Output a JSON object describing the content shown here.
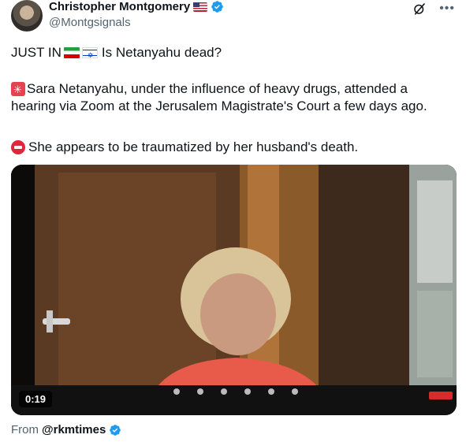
{
  "author": {
    "name": "Christopher Montgomery",
    "handle": "@Montgsignals"
  },
  "tweet": {
    "line1_prefix": "JUST IN",
    "line1_suffix": "Is Netanyahu dead?",
    "line2": "Sara Netanyahu, under the influence of heavy drugs, attended a",
    "line3": "hearing via Zoom at the Jerusalem Magistrate's Court a few days ago.",
    "line4": "She appears to be traumatized by her husband's death."
  },
  "video": {
    "duration": "0:19"
  },
  "source": {
    "prefix": "From",
    "handle": "@rkmtimes"
  },
  "icons": {
    "verified": "verified-badge-icon",
    "grok": "grok-icon",
    "more": "more-icon",
    "flag_us": "flag-us-icon",
    "flag_ir": "flag-iran-icon",
    "flag_il": "flag-israel-icon",
    "siren": "siren-icon",
    "no_entry": "no-entry-icon"
  },
  "colors": {
    "verified": "#1d9bf0",
    "text": "#0f1419",
    "muted": "#536471"
  }
}
